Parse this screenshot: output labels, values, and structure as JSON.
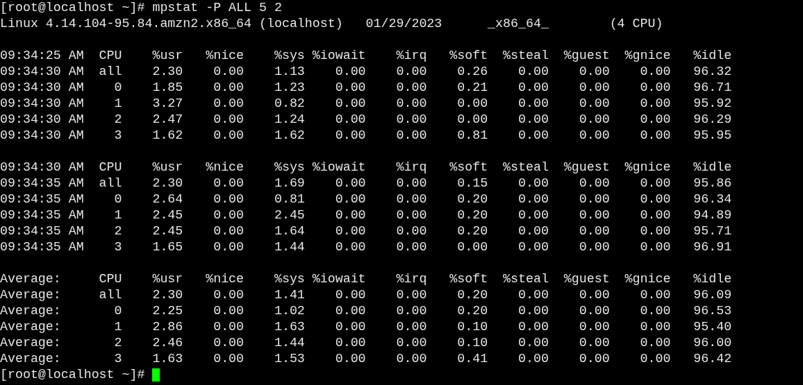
{
  "terminal": {
    "command_line": {
      "prompt": "[root@localhost ~]#",
      "command": "mpstat -P ALL 5 2"
    },
    "system_line": "Linux 4.14.104-95.84.amzn2.x86_64 (localhost)   01/29/2023      _x86_64_        (4 CPU)",
    "reports": [
      {
        "lines": [
          "09:34:25 AM  CPU    %usr   %nice    %sys %iowait    %irq   %soft  %steal  %guest  %gnice   %idle",
          "09:34:30 AM  all    2.30    0.00    1.13    0.00    0.00    0.26    0.00    0.00    0.00   96.32",
          "09:34:30 AM    0    1.85    0.00    1.23    0.00    0.00    0.21    0.00    0.00    0.00   96.71",
          "09:34:30 AM    1    3.27    0.00    0.82    0.00    0.00    0.00    0.00    0.00    0.00   95.92",
          "09:34:30 AM    2    2.47    0.00    1.24    0.00    0.00    0.00    0.00    0.00    0.00   96.29",
          "09:34:30 AM    3    1.62    0.00    1.62    0.00    0.00    0.81    0.00    0.00    0.00   95.95"
        ]
      },
      {
        "lines": [
          "09:34:30 AM  CPU    %usr   %nice    %sys %iowait    %irq   %soft  %steal  %guest  %gnice   %idle",
          "09:34:35 AM  all    2.30    0.00    1.69    0.00    0.00    0.15    0.00    0.00    0.00   95.86",
          "09:34:35 AM    0    2.64    0.00    0.81    0.00    0.00    0.20    0.00    0.00    0.00   96.34",
          "09:34:35 AM    1    2.45    0.00    2.45    0.00    0.00    0.20    0.00    0.00    0.00   94.89",
          "09:34:35 AM    2    2.45    0.00    1.64    0.00    0.00    0.20    0.00    0.00    0.00   95.71",
          "09:34:35 AM    3    1.65    0.00    1.44    0.00    0.00    0.00    0.00    0.00    0.00   96.91"
        ]
      },
      {
        "lines": [
          "Average:     CPU    %usr   %nice    %sys %iowait    %irq   %soft  %steal  %guest  %gnice   %idle",
          "Average:     all    2.30    0.00    1.41    0.00    0.00    0.20    0.00    0.00    0.00   96.09",
          "Average:       0    2.25    0.00    1.02    0.00    0.00    0.20    0.00    0.00    0.00   96.53",
          "Average:       1    2.86    0.00    1.63    0.00    0.00    0.10    0.00    0.00    0.00   95.40",
          "Average:       2    2.46    0.00    1.44    0.00    0.00    0.10    0.00    0.00    0.00   96.00",
          "Average:       3    1.63    0.00    1.53    0.00    0.00    0.41    0.00    0.00    0.00   96.42"
        ]
      }
    ],
    "final_prompt": "[root@localhost ~]#"
  }
}
